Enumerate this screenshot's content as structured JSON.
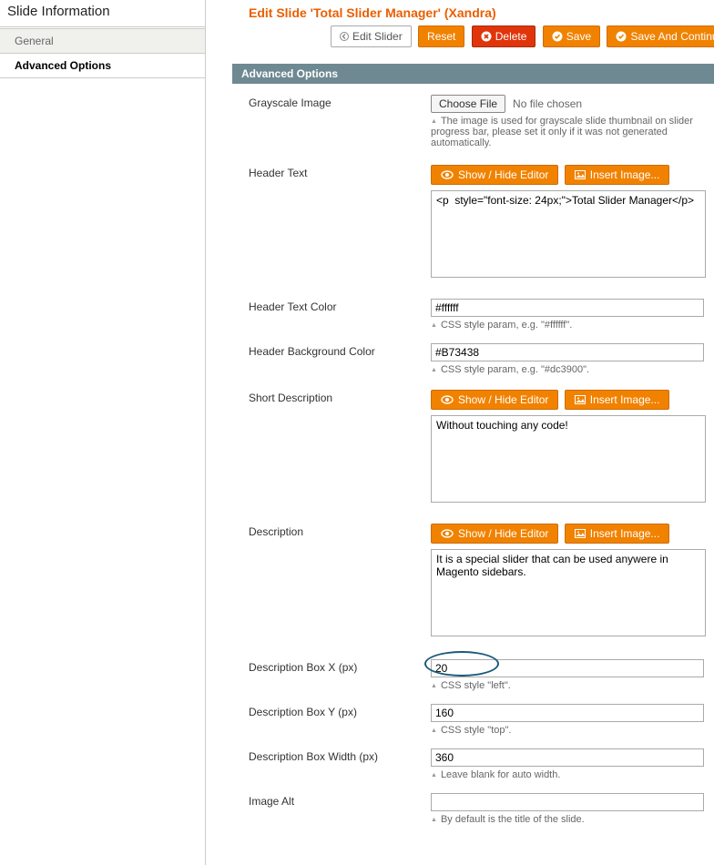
{
  "sidebar": {
    "title": "Slide Information",
    "tabs": [
      "General",
      "Advanced Options"
    ]
  },
  "header": {
    "title": "Edit Slide 'Total Slider Manager' (Xandra)"
  },
  "toolbar": {
    "back": "Edit Slider",
    "reset": "Reset",
    "delete": "Delete",
    "save": "Save",
    "savec": "Save And Continue E"
  },
  "section": {
    "title": "Advanced Options"
  },
  "fields": {
    "grayscale": {
      "label": "Grayscale Image",
      "choose": "Choose File",
      "status": "No file chosen",
      "hint": "The image is used for grayscale slide thumbnail on slider progress bar, please set it only if it was not generated automatically."
    },
    "header_text": {
      "label": "Header Text",
      "value": "<p  style=\"font-size: 24px;\">Total Slider Manager</p>"
    },
    "header_color": {
      "label": "Header Text Color",
      "value": "#ffffff",
      "hint": "CSS style param, e.g. \"#ffffff\"."
    },
    "header_bg": {
      "label": "Header Background Color",
      "value": "#B73438",
      "hint": "CSS style param, e.g. \"#dc3900\"."
    },
    "short_desc": {
      "label": "Short Description",
      "value": "Without touching any code!"
    },
    "desc": {
      "label": "Description",
      "value": "It is a special slider that can be used anywere in Magento sidebars."
    },
    "box_x": {
      "label": "Description Box X (px)",
      "value": "20",
      "hint": "CSS style \"left\"."
    },
    "box_y": {
      "label": "Description Box Y (px)",
      "value": "160",
      "hint": "CSS style \"top\"."
    },
    "box_w": {
      "label": "Description Box Width (px)",
      "value": "360",
      "hint": "Leave blank for auto width."
    },
    "alt": {
      "label": "Image Alt",
      "value": "",
      "hint": "By default is the title of the slide."
    }
  },
  "editor_btn": {
    "show": "Show / Hide Editor",
    "insert": "Insert Image..."
  }
}
